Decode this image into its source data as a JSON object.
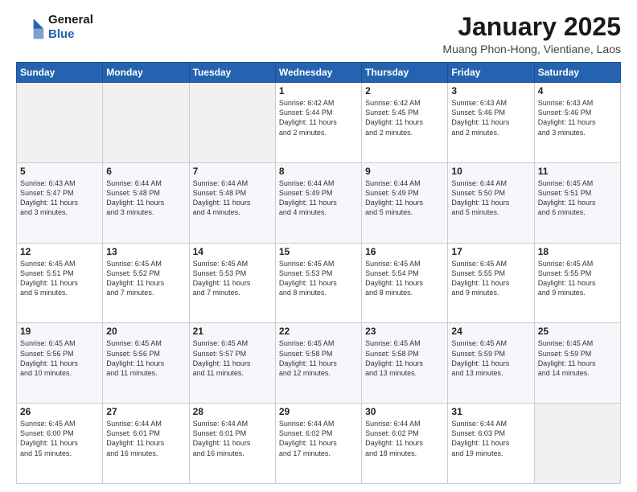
{
  "header": {
    "logo_line1": "General",
    "logo_line2": "Blue",
    "title": "January 2025",
    "subtitle": "Muang Phon-Hong, Vientiane, Laos"
  },
  "calendar": {
    "days_of_week": [
      "Sunday",
      "Monday",
      "Tuesday",
      "Wednesday",
      "Thursday",
      "Friday",
      "Saturday"
    ],
    "weeks": [
      [
        {
          "day": "",
          "info": ""
        },
        {
          "day": "",
          "info": ""
        },
        {
          "day": "",
          "info": ""
        },
        {
          "day": "1",
          "info": "Sunrise: 6:42 AM\nSunset: 5:44 PM\nDaylight: 11 hours\nand 2 minutes."
        },
        {
          "day": "2",
          "info": "Sunrise: 6:42 AM\nSunset: 5:45 PM\nDaylight: 11 hours\nand 2 minutes."
        },
        {
          "day": "3",
          "info": "Sunrise: 6:43 AM\nSunset: 5:46 PM\nDaylight: 11 hours\nand 2 minutes."
        },
        {
          "day": "4",
          "info": "Sunrise: 6:43 AM\nSunset: 5:46 PM\nDaylight: 11 hours\nand 3 minutes."
        }
      ],
      [
        {
          "day": "5",
          "info": "Sunrise: 6:43 AM\nSunset: 5:47 PM\nDaylight: 11 hours\nand 3 minutes."
        },
        {
          "day": "6",
          "info": "Sunrise: 6:44 AM\nSunset: 5:48 PM\nDaylight: 11 hours\nand 3 minutes."
        },
        {
          "day": "7",
          "info": "Sunrise: 6:44 AM\nSunset: 5:48 PM\nDaylight: 11 hours\nand 4 minutes."
        },
        {
          "day": "8",
          "info": "Sunrise: 6:44 AM\nSunset: 5:49 PM\nDaylight: 11 hours\nand 4 minutes."
        },
        {
          "day": "9",
          "info": "Sunrise: 6:44 AM\nSunset: 5:49 PM\nDaylight: 11 hours\nand 5 minutes."
        },
        {
          "day": "10",
          "info": "Sunrise: 6:44 AM\nSunset: 5:50 PM\nDaylight: 11 hours\nand 5 minutes."
        },
        {
          "day": "11",
          "info": "Sunrise: 6:45 AM\nSunset: 5:51 PM\nDaylight: 11 hours\nand 6 minutes."
        }
      ],
      [
        {
          "day": "12",
          "info": "Sunrise: 6:45 AM\nSunset: 5:51 PM\nDaylight: 11 hours\nand 6 minutes."
        },
        {
          "day": "13",
          "info": "Sunrise: 6:45 AM\nSunset: 5:52 PM\nDaylight: 11 hours\nand 7 minutes."
        },
        {
          "day": "14",
          "info": "Sunrise: 6:45 AM\nSunset: 5:53 PM\nDaylight: 11 hours\nand 7 minutes."
        },
        {
          "day": "15",
          "info": "Sunrise: 6:45 AM\nSunset: 5:53 PM\nDaylight: 11 hours\nand 8 minutes."
        },
        {
          "day": "16",
          "info": "Sunrise: 6:45 AM\nSunset: 5:54 PM\nDaylight: 11 hours\nand 8 minutes."
        },
        {
          "day": "17",
          "info": "Sunrise: 6:45 AM\nSunset: 5:55 PM\nDaylight: 11 hours\nand 9 minutes."
        },
        {
          "day": "18",
          "info": "Sunrise: 6:45 AM\nSunset: 5:55 PM\nDaylight: 11 hours\nand 9 minutes."
        }
      ],
      [
        {
          "day": "19",
          "info": "Sunrise: 6:45 AM\nSunset: 5:56 PM\nDaylight: 11 hours\nand 10 minutes."
        },
        {
          "day": "20",
          "info": "Sunrise: 6:45 AM\nSunset: 5:56 PM\nDaylight: 11 hours\nand 11 minutes."
        },
        {
          "day": "21",
          "info": "Sunrise: 6:45 AM\nSunset: 5:57 PM\nDaylight: 11 hours\nand 11 minutes."
        },
        {
          "day": "22",
          "info": "Sunrise: 6:45 AM\nSunset: 5:58 PM\nDaylight: 11 hours\nand 12 minutes."
        },
        {
          "day": "23",
          "info": "Sunrise: 6:45 AM\nSunset: 5:58 PM\nDaylight: 11 hours\nand 13 minutes."
        },
        {
          "day": "24",
          "info": "Sunrise: 6:45 AM\nSunset: 5:59 PM\nDaylight: 11 hours\nand 13 minutes."
        },
        {
          "day": "25",
          "info": "Sunrise: 6:45 AM\nSunset: 5:59 PM\nDaylight: 11 hours\nand 14 minutes."
        }
      ],
      [
        {
          "day": "26",
          "info": "Sunrise: 6:45 AM\nSunset: 6:00 PM\nDaylight: 11 hours\nand 15 minutes."
        },
        {
          "day": "27",
          "info": "Sunrise: 6:44 AM\nSunset: 6:01 PM\nDaylight: 11 hours\nand 16 minutes."
        },
        {
          "day": "28",
          "info": "Sunrise: 6:44 AM\nSunset: 6:01 PM\nDaylight: 11 hours\nand 16 minutes."
        },
        {
          "day": "29",
          "info": "Sunrise: 6:44 AM\nSunset: 6:02 PM\nDaylight: 11 hours\nand 17 minutes."
        },
        {
          "day": "30",
          "info": "Sunrise: 6:44 AM\nSunset: 6:02 PM\nDaylight: 11 hours\nand 18 minutes."
        },
        {
          "day": "31",
          "info": "Sunrise: 6:44 AM\nSunset: 6:03 PM\nDaylight: 11 hours\nand 19 minutes."
        },
        {
          "day": "",
          "info": ""
        }
      ]
    ]
  }
}
